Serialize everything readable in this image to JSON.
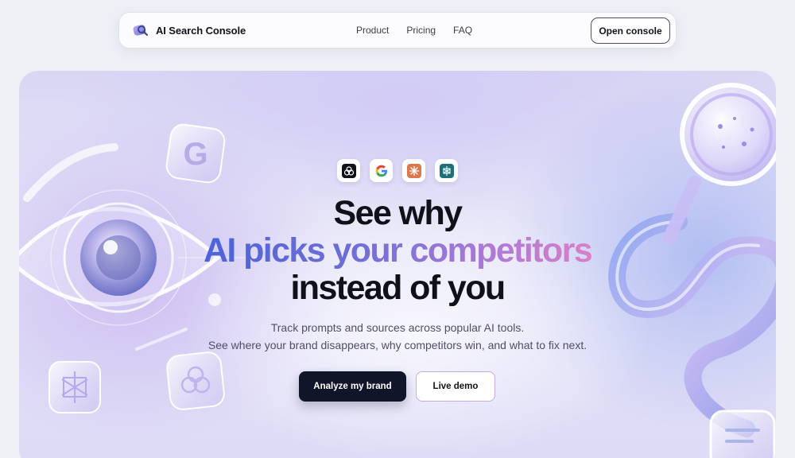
{
  "nav": {
    "brand": "AI Search Console",
    "menu": [
      "Product",
      "Pricing",
      "FAQ"
    ],
    "cta": "Open console"
  },
  "hero": {
    "ai_tools": [
      "chatgpt-icon",
      "google-icon",
      "claude-icon",
      "perplexity-icon"
    ],
    "headline_line1": "See why",
    "headline_line2": "AI picks your competitors",
    "headline_line3": "instead of you",
    "subtitle_line1": "Track prompts and sources across popular AI tools.",
    "subtitle_line2": "See where your brand disappears, why competitors win, and what to fix next.",
    "primary_cta": "Analyze my brand",
    "secondary_cta": "Live demo"
  },
  "colors": {
    "accent_gradient_start": "#4b63d8",
    "accent_gradient_end": "#d97fc6",
    "primary_button": "#11152a",
    "claude_orange": "#d9774f",
    "perplexity_teal": "#1f6f7a"
  }
}
